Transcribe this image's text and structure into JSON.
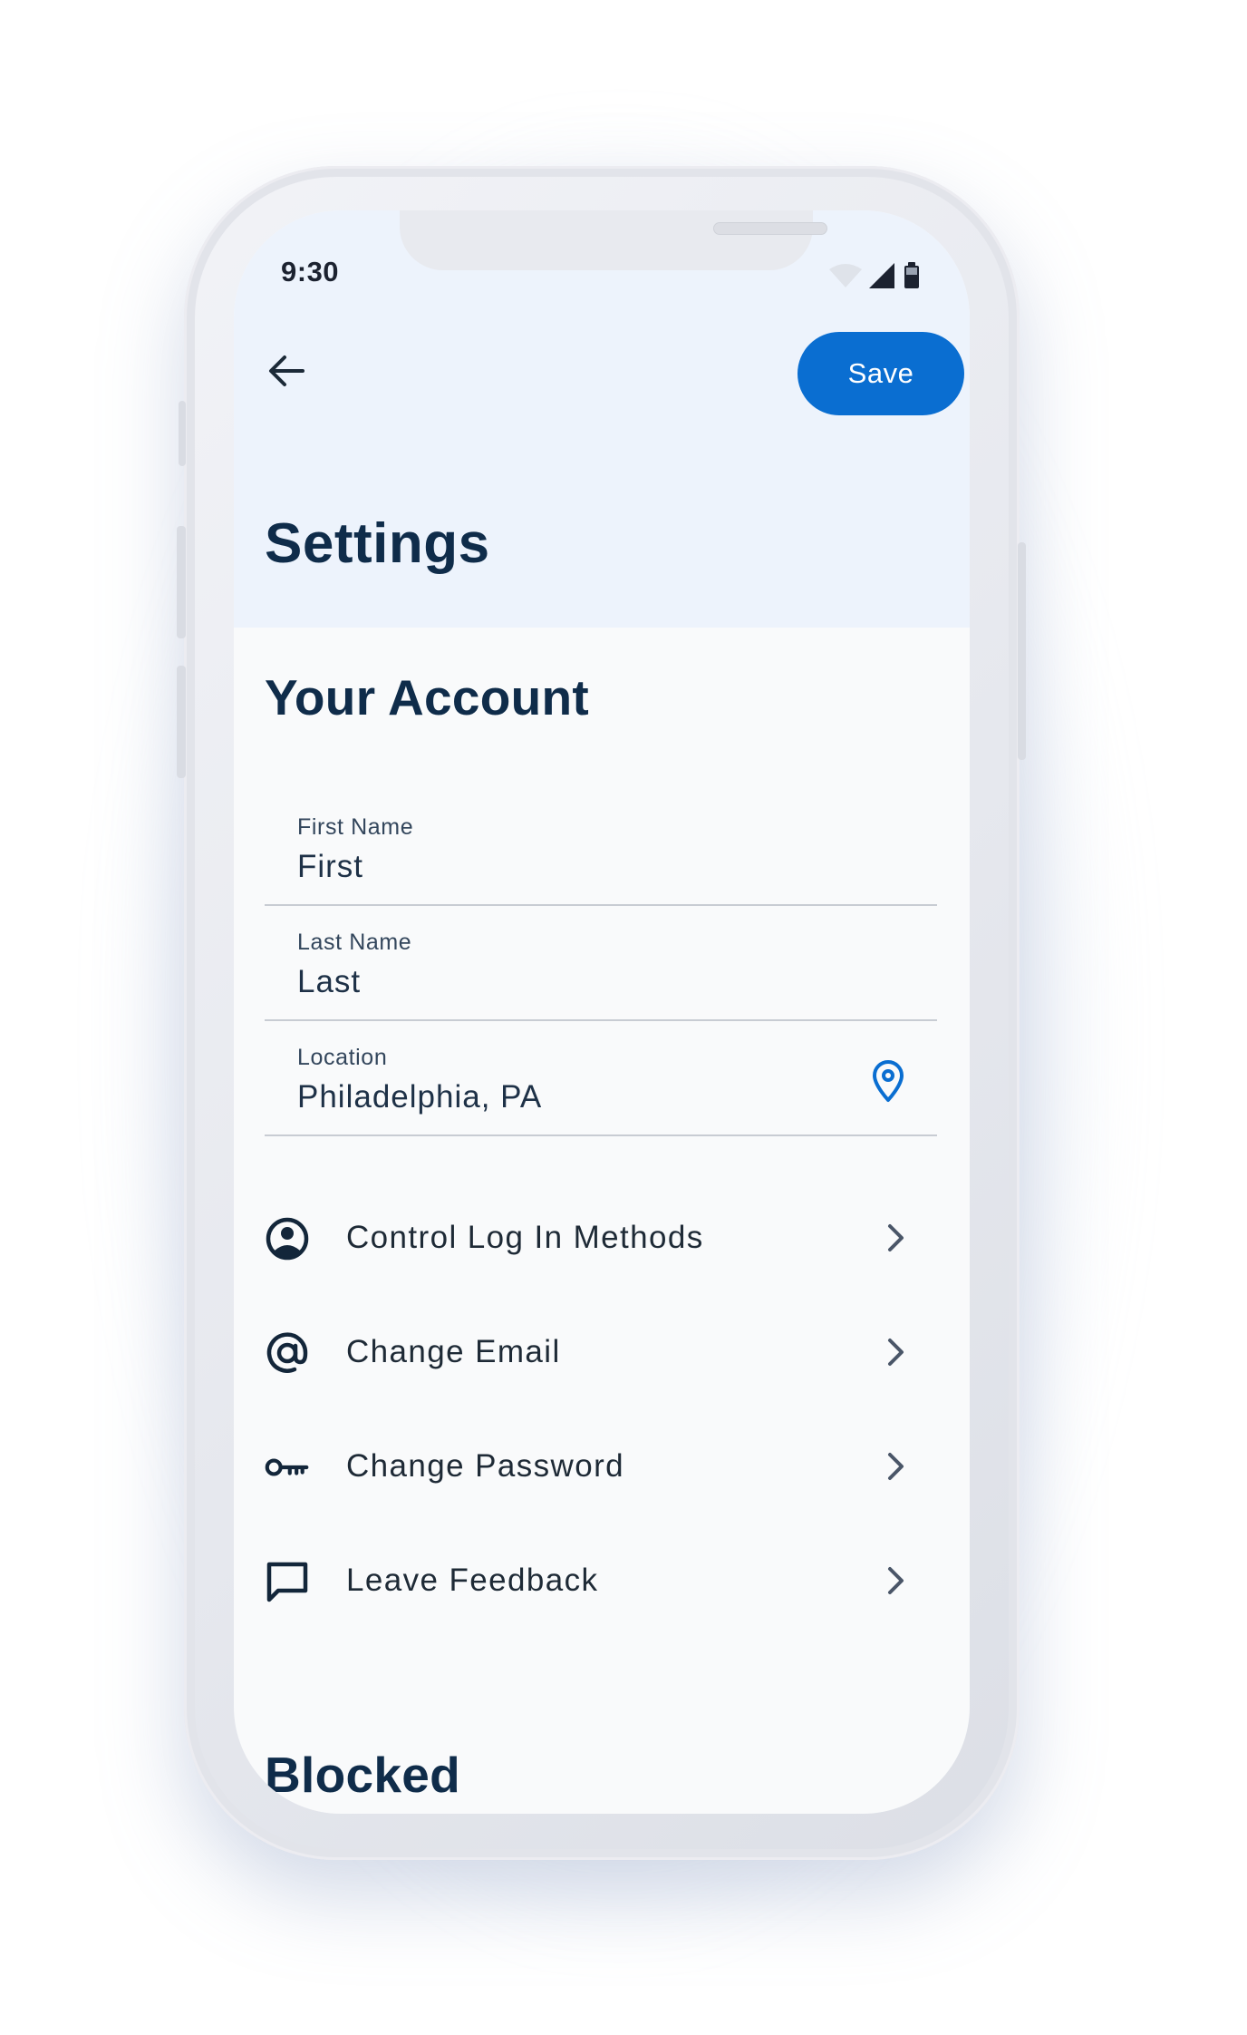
{
  "status_bar": {
    "time": "9:30",
    "icons": [
      "wifi-icon",
      "cellular-signal-icon",
      "battery-icon"
    ]
  },
  "header": {
    "back_icon": "arrow-left-icon",
    "save_label": "Save",
    "title": "Settings"
  },
  "account": {
    "title": "Your Account",
    "fields": [
      {
        "label": "First Name",
        "value": "First"
      },
      {
        "label": "Last Name",
        "value": "Last"
      },
      {
        "label": "Location",
        "value": "Philadelphia, PA",
        "icon": "map-pin-icon"
      }
    ]
  },
  "menu": [
    {
      "label": "Control Log In Methods",
      "icon": "user-circle-icon"
    },
    {
      "label": "Change Email",
      "icon": "at-sign-icon"
    },
    {
      "label": "Change Password",
      "icon": "key-icon"
    },
    {
      "label": "Leave Feedback",
      "icon": "message-square-icon"
    }
  ],
  "blocked": {
    "title": "Blocked"
  },
  "colors": {
    "accent": "#0a6ed1",
    "header_background": "#edf3fc",
    "title_text": "#0f2c4a"
  }
}
